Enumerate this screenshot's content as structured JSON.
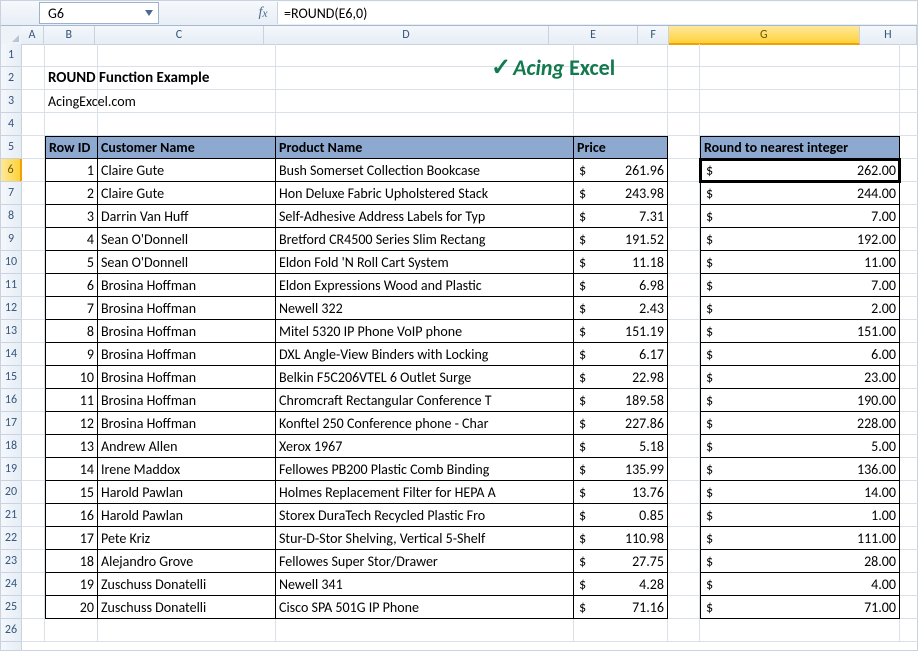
{
  "nameBox": "G6",
  "formula": "=ROUND(E6,0)",
  "cols": [
    "A",
    "B",
    "C",
    "D",
    "E",
    "F",
    "G",
    "H"
  ],
  "selectedCol": "G",
  "selectedRow": 6,
  "title": "ROUND Function Example",
  "subtitle": "AcingExcel.com",
  "logo": {
    "check": "✓",
    "brand": "Acing",
    "brand2": "Excel"
  },
  "headers": {
    "rowId": "Row ID",
    "customer": "Customer Name",
    "product": "Product Name",
    "price": "Price"
  },
  "roundHeader": "Round to nearest integer",
  "rows": [
    {
      "id": 1,
      "customer": "Claire Gute",
      "product": "Bush Somerset Collection Bookcase",
      "price": "261.96",
      "round": "262.00"
    },
    {
      "id": 2,
      "customer": "Claire Gute",
      "product": "Hon Deluxe Fabric Upholstered Stack",
      "price": "243.98",
      "round": "244.00"
    },
    {
      "id": 3,
      "customer": "Darrin Van Huff",
      "product": "Self-Adhesive Address Labels for Typ",
      "price": "7.31",
      "round": "7.00"
    },
    {
      "id": 4,
      "customer": "Sean O'Donnell",
      "product": "Bretford CR4500 Series Slim Rectang",
      "price": "191.52",
      "round": "192.00"
    },
    {
      "id": 5,
      "customer": "Sean O'Donnell",
      "product": "Eldon Fold 'N Roll Cart System",
      "price": "11.18",
      "round": "11.00"
    },
    {
      "id": 6,
      "customer": "Brosina Hoffman",
      "product": "Eldon Expressions Wood and Plastic",
      "price": "6.98",
      "round": "7.00"
    },
    {
      "id": 7,
      "customer": "Brosina Hoffman",
      "product": "Newell 322",
      "price": "2.43",
      "round": "2.00"
    },
    {
      "id": 8,
      "customer": "Brosina Hoffman",
      "product": "Mitel 5320 IP Phone VoIP phone",
      "price": "151.19",
      "round": "151.00"
    },
    {
      "id": 9,
      "customer": "Brosina Hoffman",
      "product": "DXL Angle-View Binders with Locking",
      "price": "6.17",
      "round": "6.00"
    },
    {
      "id": 10,
      "customer": "Brosina Hoffman",
      "product": "Belkin F5C206VTEL 6 Outlet Surge",
      "price": "22.98",
      "round": "23.00"
    },
    {
      "id": 11,
      "customer": "Brosina Hoffman",
      "product": "Chromcraft Rectangular Conference T",
      "price": "189.58",
      "round": "190.00"
    },
    {
      "id": 12,
      "customer": "Brosina Hoffman",
      "product": "Konftel 250 Conference phone - Char",
      "price": "227.86",
      "round": "228.00"
    },
    {
      "id": 13,
      "customer": "Andrew Allen",
      "product": "Xerox 1967",
      "price": "5.18",
      "round": "5.00"
    },
    {
      "id": 14,
      "customer": "Irene Maddox",
      "product": "Fellowes PB200 Plastic Comb Binding",
      "price": "135.99",
      "round": "136.00"
    },
    {
      "id": 15,
      "customer": "Harold Pawlan",
      "product": "Holmes Replacement Filter for HEPA A",
      "price": "13.76",
      "round": "14.00"
    },
    {
      "id": 16,
      "customer": "Harold Pawlan",
      "product": "Storex DuraTech Recycled Plastic Fro",
      "price": "0.85",
      "round": "1.00"
    },
    {
      "id": 17,
      "customer": "Pete Kriz",
      "product": "Stur-D-Stor Shelving, Vertical 5-Shelf",
      "price": "110.98",
      "round": "111.00"
    },
    {
      "id": 18,
      "customer": "Alejandro Grove",
      "product": "Fellowes Super Stor/Drawer",
      "price": "27.75",
      "round": "28.00"
    },
    {
      "id": 19,
      "customer": "Zuschuss Donatelli",
      "product": "Newell 341",
      "price": "4.28",
      "round": "4.00"
    },
    {
      "id": 20,
      "customer": "Zuschuss Donatelli",
      "product": "Cisco SPA 501G IP Phone",
      "price": "71.16",
      "round": "71.00"
    }
  ]
}
